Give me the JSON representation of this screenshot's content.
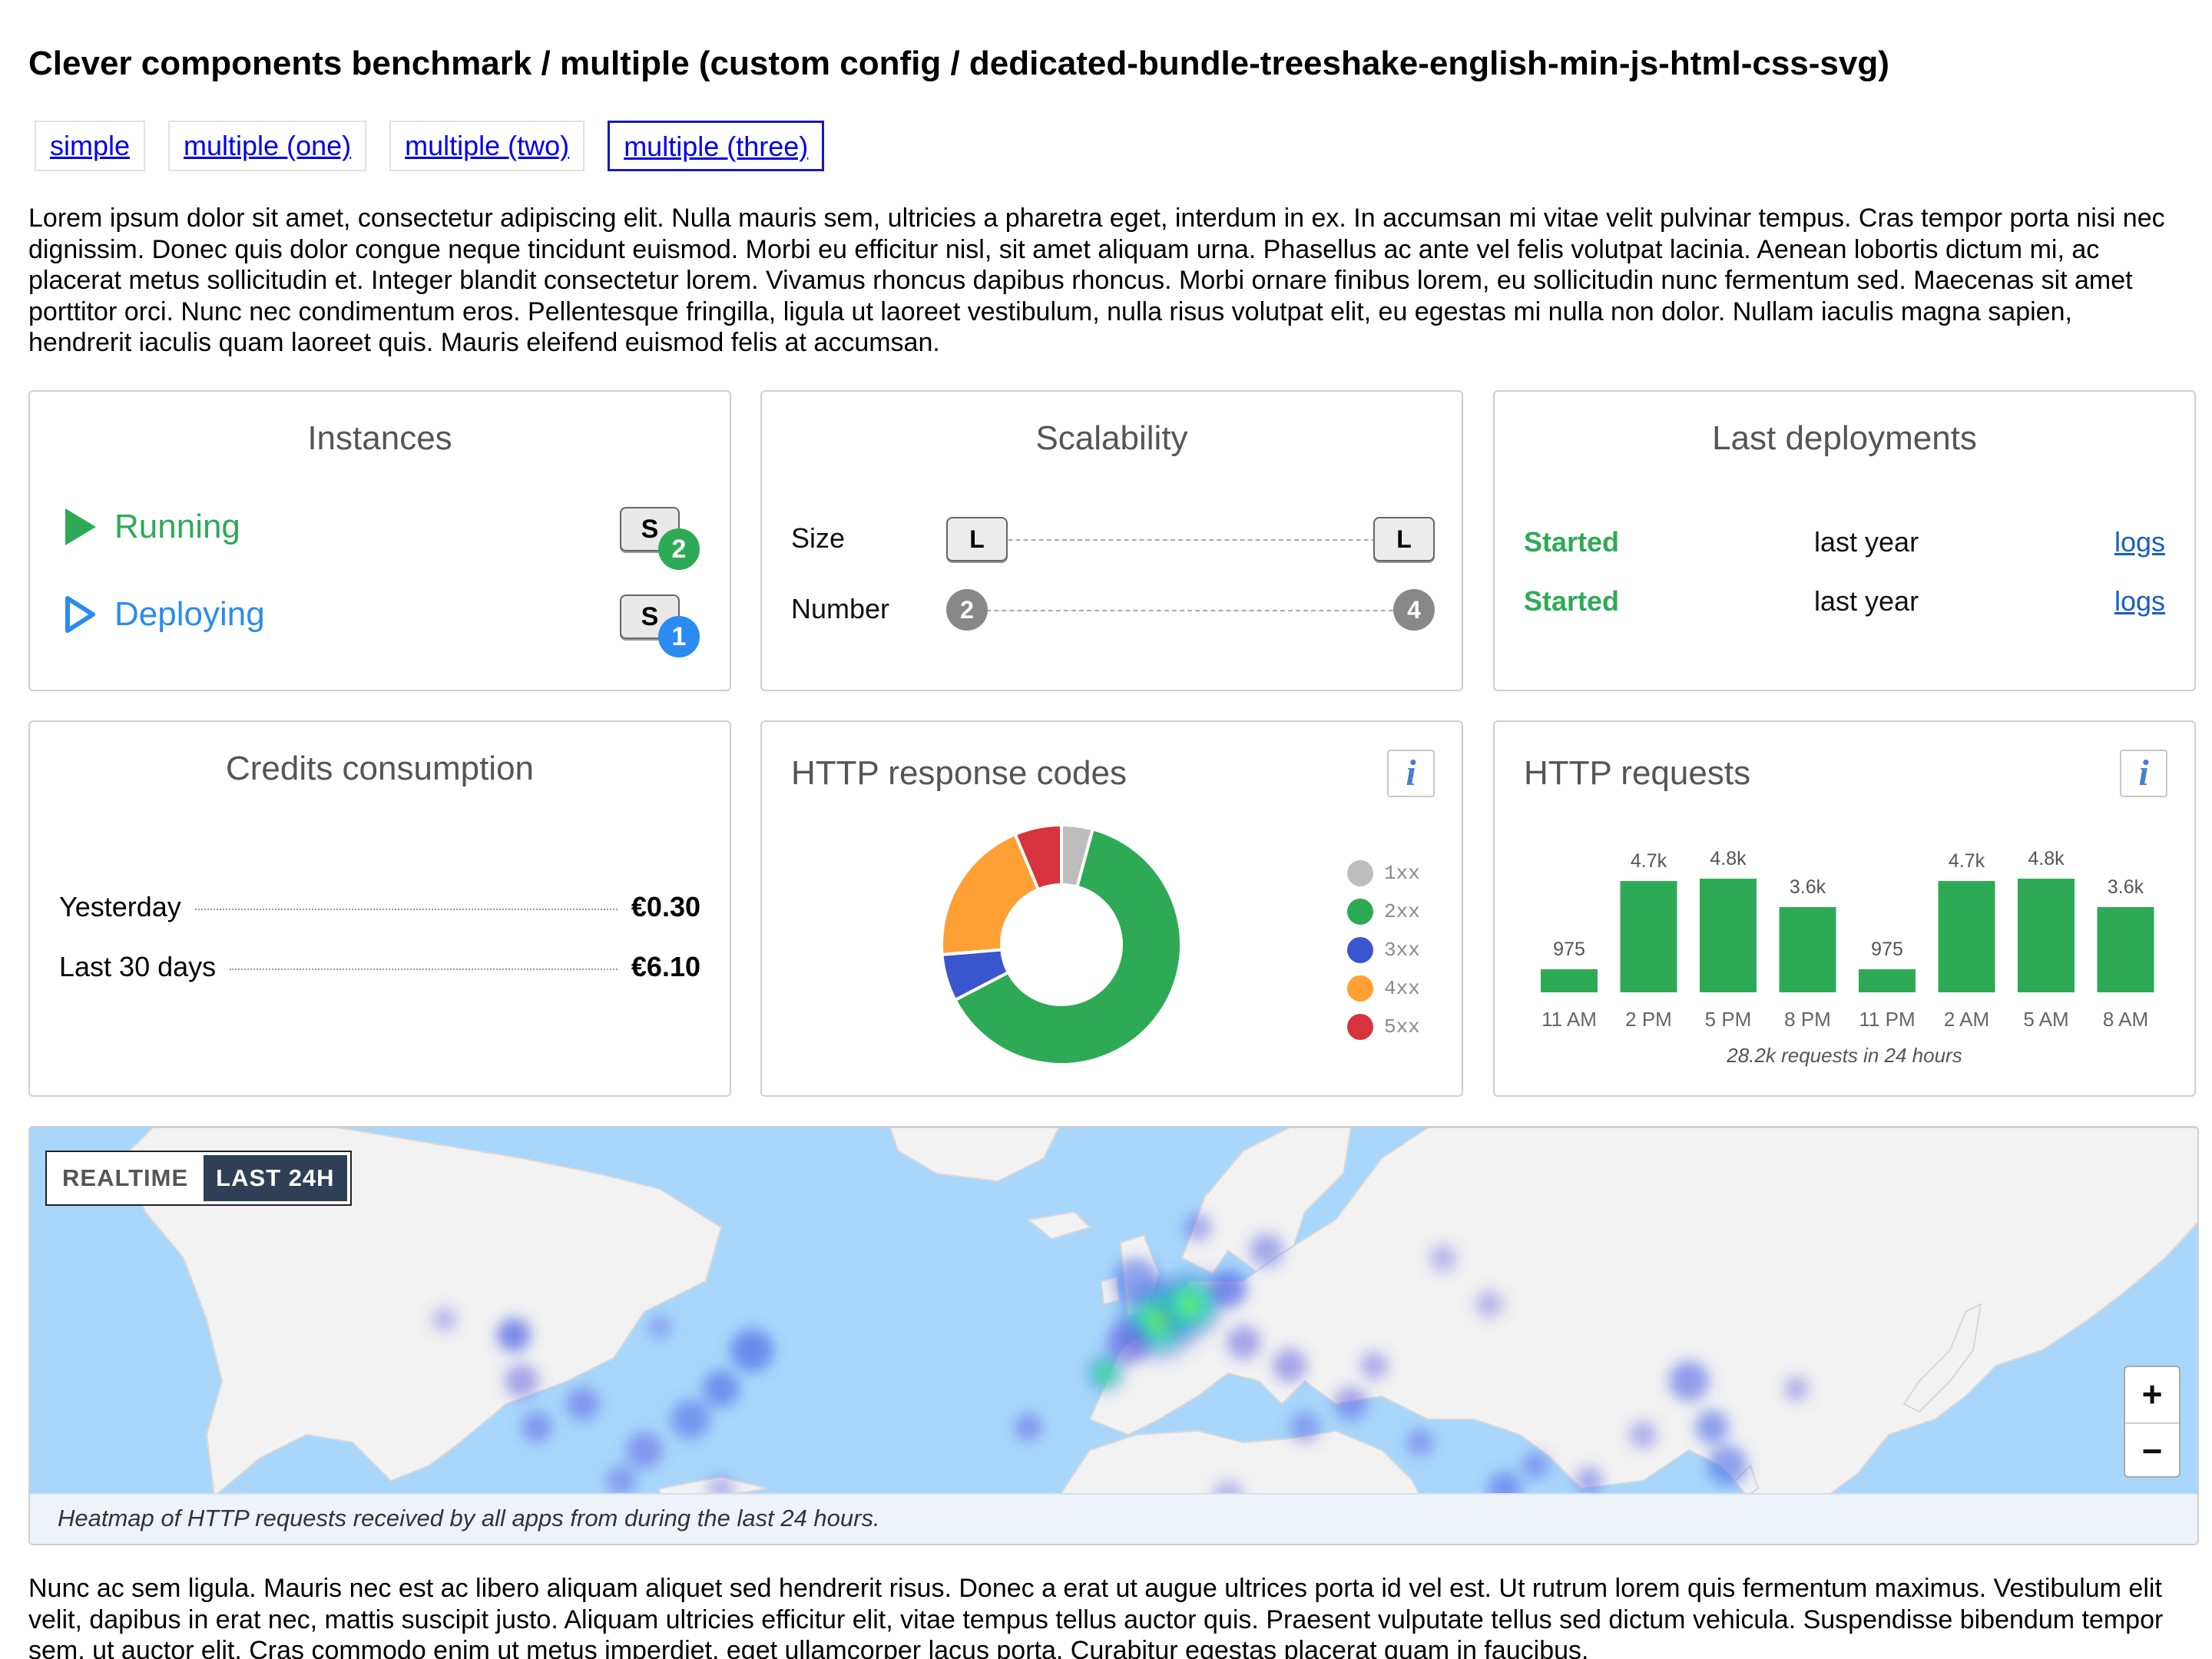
{
  "header": {
    "title": "Clever components benchmark / multiple (custom config / dedicated-bundle-treeshake-english-min-js-html-css-svg)"
  },
  "nav": {
    "links": [
      {
        "label": "simple"
      },
      {
        "label": "multiple (one)"
      },
      {
        "label": "multiple (two)"
      },
      {
        "label": "multiple (three)",
        "active": true
      }
    ]
  },
  "intro_text": "Lorem ipsum dolor sit amet, consectetur adipiscing elit. Nulla mauris sem, ultricies a pharetra eget, interdum in ex. In accumsan mi vitae velit pulvinar tempus. Cras tempor porta nisi nec dignissim. Donec quis dolor congue neque tincidunt euismod. Morbi eu efficitur nisl, sit amet aliquam urna. Phasellus ac ante vel felis volutpat lacinia. Aenean lobortis dictum mi, ac placerat metus sollicitudin et. Integer blandit consectetur lorem. Vivamus rhoncus dapibus rhoncus. Morbi ornare finibus lorem, eu sollicitudin nunc fermentum sed. Maecenas sit amet porttitor orci. Nunc nec condimentum eros. Pellentesque fringilla, ligula ut laoreet vestibulum, nulla risus volutpat elit, eu egestas mi nulla non dolor. Nullam iaculis magna sapien, hendrerit iaculis quam laoreet quis. Mauris eleifend euismod felis at accumsan.",
  "instances": {
    "title": "Instances",
    "rows": [
      {
        "label": "Running",
        "size": "S",
        "count": "2",
        "color": "#2eaa56",
        "icon": "play-filled-icon"
      },
      {
        "label": "Deploying",
        "size": "S",
        "count": "1",
        "color": "#2a8cf0",
        "icon": "play-outline-icon"
      }
    ]
  },
  "scalability": {
    "title": "Scalability",
    "size": {
      "label": "Size",
      "min": "L",
      "max": "L"
    },
    "number": {
      "label": "Number",
      "min": "2",
      "max": "4"
    }
  },
  "deployments": {
    "title": "Last deployments",
    "rows": [
      {
        "state": "Started",
        "when": "last year",
        "link": "logs"
      },
      {
        "state": "Started",
        "when": "last year",
        "link": "logs"
      }
    ]
  },
  "credits": {
    "title": "Credits consumption",
    "rows": [
      {
        "label": "Yesterday",
        "value": "€0.30"
      },
      {
        "label": "Last 30 days",
        "value": "€6.10"
      }
    ]
  },
  "response_codes": {
    "title": "HTTP response codes",
    "info_icon": "info-icon"
  },
  "requests": {
    "title": "HTTP requests",
    "caption": "28.2k requests in 24 hours",
    "info_icon": "info-icon"
  },
  "colors": {
    "green": "#2eaa56",
    "blue": "#2a8cf0",
    "link": "#1a5ec2"
  },
  "chart_data": [
    {
      "type": "pie",
      "categories": [
        "1xx",
        "2xx",
        "3xx",
        "4xx",
        "5xx"
      ],
      "values": [
        4,
        60,
        6,
        19,
        6
      ],
      "colors": [
        "#bdbdbd",
        "#2eaa56",
        "#3b55cf",
        "#ffa034",
        "#d7333e"
      ],
      "legend": "right",
      "labels": [
        "1xx",
        "2xx",
        "3xx",
        "4xx",
        "5xx"
      ]
    },
    {
      "type": "bar",
      "categories": [
        "11 AM",
        "2 PM",
        "5 PM",
        "8 PM",
        "11 PM",
        "2 AM",
        "5 AM",
        "8 AM"
      ],
      "values": [
        975,
        4700,
        4800,
        3600,
        975,
        4700,
        4800,
        3600
      ],
      "value_labels": [
        "975",
        "4.7k",
        "4.8k",
        "3.6k",
        "975",
        "4.7k",
        "4.8k",
        "3.6k"
      ],
      "color": "#2eaa56",
      "ylim": [
        0,
        4800
      ],
      "grid": false
    }
  ],
  "map": {
    "toggle": {
      "realtime": "REALTIME",
      "last24": "LAST 24H",
      "selected": "LAST 24H"
    },
    "zoom_in": "+",
    "zoom_out": "−",
    "caption": "Heatmap of HTTP requests received by all apps from during the last 24 hours."
  },
  "outro_text": "Nunc ac sem ligula. Mauris nec est ac libero aliquam aliquet sed hendrerit risus. Donec a erat ut augue ultrices porta id vel est. Ut rutrum lorem quis fermentum maximus. Vestibulum elit velit, dapibus in erat nec, mattis suscipit justo. Aliquam ultricies efficitur elit, vitae tempus tellus auctor quis. Praesent vulputate tellus sed dictum vehicula. Suspendisse bibendum tempor sem, ut auctor elit. Cras commodo enim ut metus imperdiet, eget ullamcorper lacus porta. Curabitur egestas placerat quam in faucibus."
}
